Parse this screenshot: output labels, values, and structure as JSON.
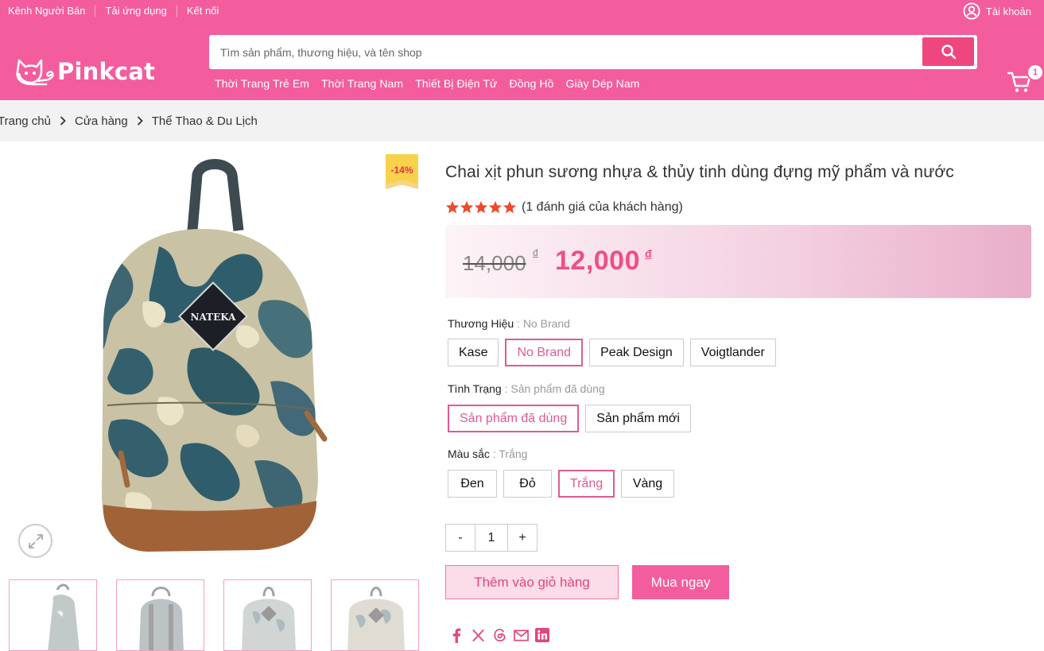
{
  "topbar": {
    "links": [
      "Kênh Người Bán",
      "Tải ứng dụng",
      "Kết nối"
    ],
    "account_label": "Tài khoản"
  },
  "logo": {
    "text": "Pinkcat"
  },
  "search": {
    "placeholder": "Tìm sản phẩm, thương hiệu, và tên shop"
  },
  "categories": [
    "Thời Trang Trẻ Em",
    "Thời Trang Nam",
    "Thiết Bị Điện Tử",
    "Đồng Hồ",
    "Giày Dép Nam"
  ],
  "cart": {
    "count": "1"
  },
  "breadcrumb": [
    "Trang chủ",
    "Cửa hàng",
    "Thể Thao & Du Lịch"
  ],
  "product": {
    "sale_badge": "-14%",
    "bag_label": "NATEKA",
    "title": "Chai xịt phun sương nhựa & thủy tinh dùng đựng mỹ phẩm và nước",
    "rating": 5,
    "review_text": "(1 đánh giá của khách hàng)",
    "old_price": "14,000",
    "new_price": "12,000",
    "currency": "đ"
  },
  "attributes": {
    "brand": {
      "label": "Thương Hiệu",
      "selected": ": No Brand",
      "options": [
        "Kase",
        "No Brand",
        "Peak Design",
        "Voigtlander"
      ]
    },
    "condition": {
      "label": "Tình Trạng",
      "selected": ": Sản phẩm đã dùng",
      "options": [
        "Sản phẩm đã dùng",
        "Sản phẩm mới"
      ]
    },
    "color": {
      "label": "Màu sắc",
      "selected": ": Trắng",
      "options": [
        "Đen",
        "Đỏ",
        "Trắng",
        "Vàng"
      ]
    }
  },
  "quantity": {
    "minus": "-",
    "value": "1",
    "plus": "+"
  },
  "actions": {
    "add_to_cart": "Thêm vào giỏ hàng",
    "buy_now": "Mua ngay"
  },
  "share_icons": [
    "facebook-icon",
    "x-icon",
    "threads-icon",
    "email-icon",
    "linkedin-icon"
  ],
  "colors": {
    "brand_pink": "#f35d9d",
    "price_pink": "#ef4f86",
    "selected_border": "#e05a92"
  }
}
